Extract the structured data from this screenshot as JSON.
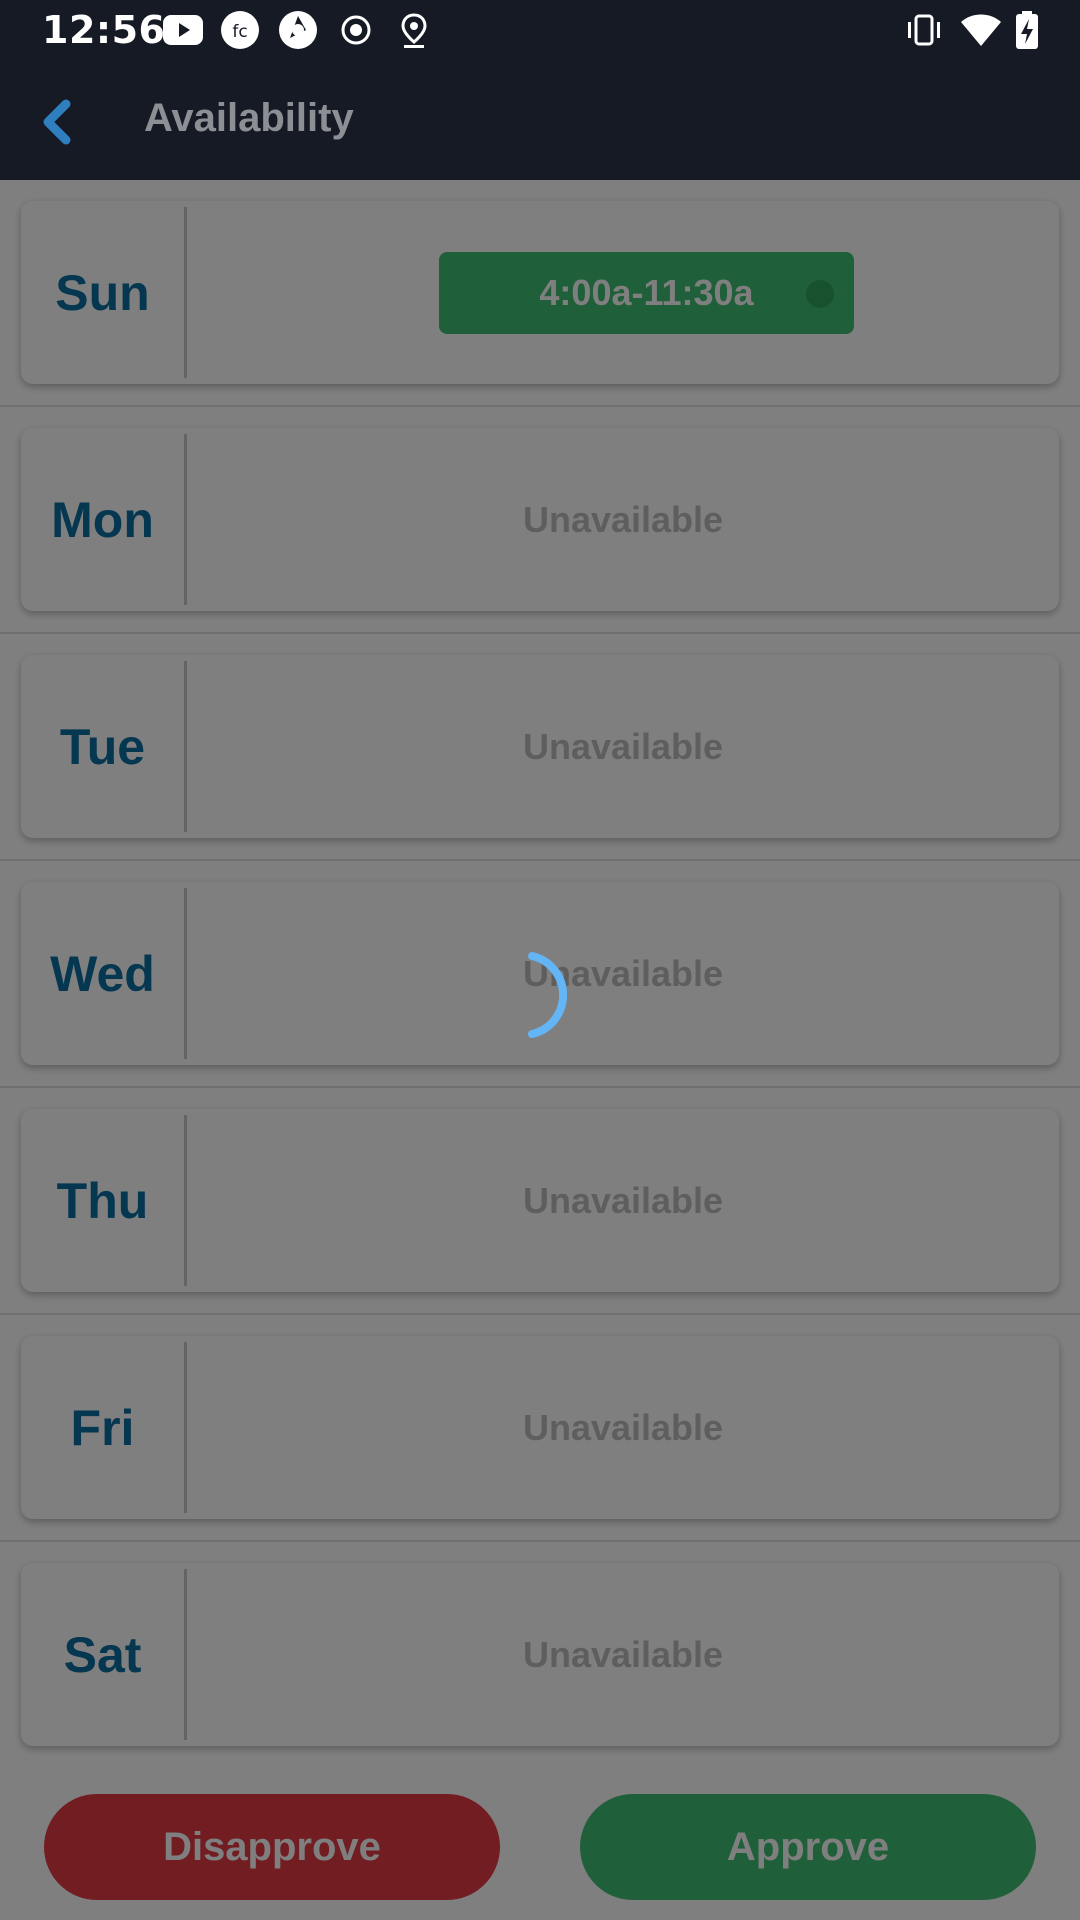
{
  "status_bar": {
    "time": "12:56",
    "left_icons": [
      "youtube-icon",
      "fc-app-icon",
      "camera-aperture-icon",
      "record-icon",
      "location-pin-icon"
    ],
    "right_icons": [
      "vibrate-icon",
      "wifi-icon",
      "battery-charging-icon"
    ]
  },
  "app_bar": {
    "title": "Availability",
    "back_icon": "chevron-left-icon"
  },
  "days": [
    {
      "label": "Sun",
      "slot": "4:00a-11:30a"
    },
    {
      "label": "Mon",
      "status": "Unavailable"
    },
    {
      "label": "Tue",
      "status": "Unavailable"
    },
    {
      "label": "Wed",
      "status": "Unavailable"
    },
    {
      "label": "Thu",
      "status": "Unavailable"
    },
    {
      "label": "Fri",
      "status": "Unavailable"
    },
    {
      "label": "Sat",
      "status": "Unavailable"
    }
  ],
  "actions": {
    "disapprove": "Disapprove",
    "approve": "Approve"
  },
  "colors": {
    "app_bar": "#151a24",
    "day_label": "#0a6fa3",
    "slot_chip": "#3fbf73",
    "disapprove": "#e23a45",
    "approve": "#3fbf73",
    "spinner": "#64b5f6"
  },
  "loading": true
}
